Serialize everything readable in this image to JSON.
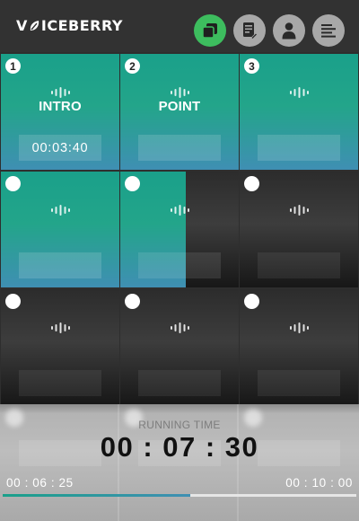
{
  "app": {
    "logo_text": "VOICEBERRY",
    "logo_prefix": "V",
    "logo_suffix": "ICEBERRY"
  },
  "header": {
    "buttons": [
      {
        "name": "board-view-button",
        "icon": "squares-icon",
        "active": true,
        "color": "#3dbd5e"
      },
      {
        "name": "script-button",
        "icon": "document-edit-icon"
      },
      {
        "name": "profile-button",
        "icon": "person-icon"
      },
      {
        "name": "menu-button",
        "icon": "list-lines-icon"
      }
    ]
  },
  "tiles": [
    {
      "number": "1",
      "title": "INTRO",
      "time": "00:03:40",
      "state": "done"
    },
    {
      "number": "2",
      "title": "POINT",
      "time": "",
      "state": "done"
    },
    {
      "number": "3",
      "title": "",
      "time": "",
      "state": "done"
    },
    {
      "number": "",
      "title": "",
      "time": "",
      "state": "done"
    },
    {
      "number": "",
      "title": "",
      "time": "",
      "state": "in-progress",
      "progress": 0.55
    },
    {
      "number": "",
      "title": "",
      "time": "",
      "state": "empty"
    },
    {
      "number": "",
      "title": "",
      "time": "",
      "state": "empty"
    },
    {
      "number": "",
      "title": "",
      "time": "",
      "state": "empty"
    },
    {
      "number": "",
      "title": "",
      "time": "",
      "state": "empty"
    }
  ],
  "running": {
    "label": "RUNNING TIME",
    "time": "00 : 07 : 30",
    "elapsed": "00 : 06 : 25",
    "total": "00 : 10 : 00",
    "progress": 0.53
  },
  "colors": {
    "accent_teal": "#1aa08a",
    "accent_blue": "#3f8fb3",
    "active_green": "#3dbd5e"
  }
}
